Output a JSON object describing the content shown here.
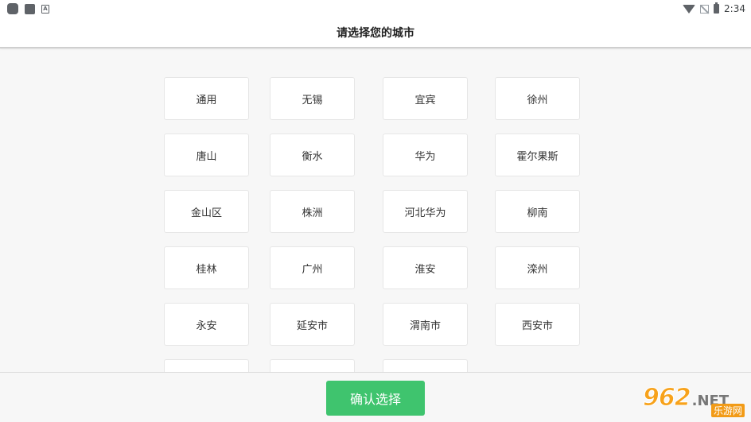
{
  "status_bar": {
    "left_icons": [
      "app-notification-icon",
      "square-notification-icon",
      "font-notification-icon"
    ],
    "font_icon_glyph": "A",
    "right_icons": [
      "wifi-icon",
      "no-signal-icon",
      "battery-charging-icon"
    ],
    "time": "2:34"
  },
  "header": {
    "title": "请选择您的城市"
  },
  "cities": [
    "通用",
    "无锡",
    "宜宾",
    "徐州",
    "唐山",
    "衡水",
    "华为",
    "霍尔果斯",
    "金山区",
    "株洲",
    "河北华为",
    "柳南",
    "桂林",
    "广州",
    "淮安",
    "滦州",
    "永安",
    "延安市",
    "渭南市",
    "西安市",
    "",
    "",
    ""
  ],
  "footer": {
    "confirm_label": "确认选择"
  },
  "watermark": {
    "number": "962",
    "suffix": ".NET",
    "sub": "乐游网"
  },
  "colors": {
    "accent": "#3fc46e",
    "background": "#f7f7f7",
    "watermark": "#f7a21b"
  }
}
